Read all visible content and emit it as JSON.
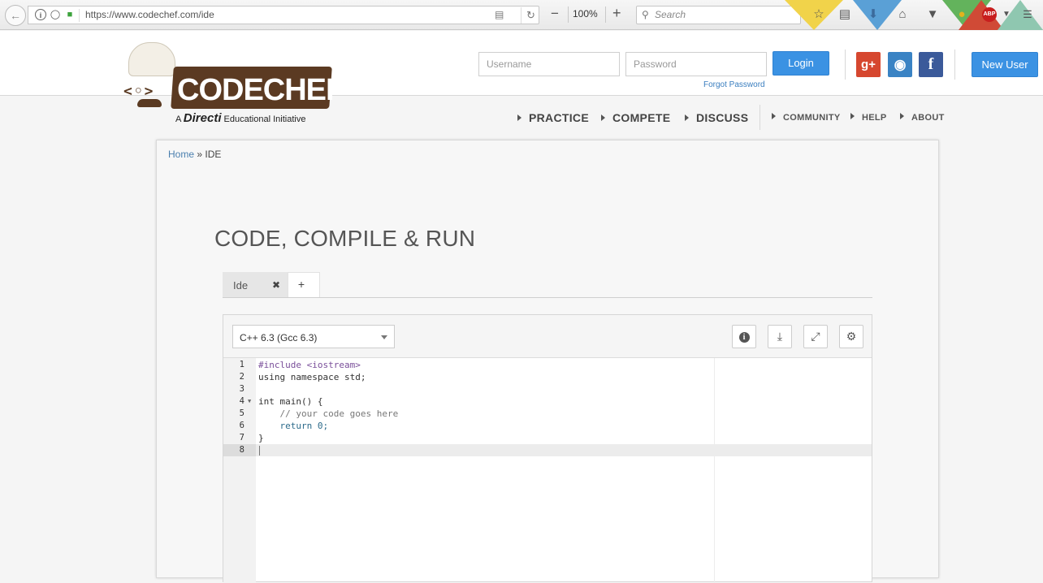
{
  "browser": {
    "back_icon": "back-arrow-icon",
    "url": "https://www.codechef.com/ide",
    "zoom_level": "100%",
    "zoom_out": "−",
    "zoom_in": "+",
    "search_placeholder": "Search"
  },
  "header": {
    "logo_text": "CODECHEF",
    "logo_brackets": "<◦>",
    "tagline_prefix": "A",
    "tagline_brand": "Directi",
    "tagline_suffix": "Educational Initiative",
    "username_placeholder": "Username",
    "password_placeholder": "Password",
    "login_label": "Login",
    "forgot_password": "Forgot Password",
    "new_user_label": "New User",
    "social": [
      {
        "label": "g+",
        "icon": "google-plus-icon"
      },
      {
        "label": "◉",
        "icon": "github-icon"
      },
      {
        "label": "f",
        "icon": "facebook-icon"
      }
    ]
  },
  "nav": {
    "main": [
      "PRACTICE",
      "COMPETE",
      "DISCUSS"
    ],
    "secondary": [
      "COMMUNITY",
      "HELP",
      "ABOUT"
    ]
  },
  "breadcrumb": {
    "home": "Home",
    "separator": "»",
    "current": "IDE"
  },
  "page": {
    "title": "CODE, COMPILE & RUN"
  },
  "tabs": {
    "items": [
      {
        "label": "Ide",
        "close": "✖"
      }
    ],
    "add_label": "+"
  },
  "editor": {
    "language": "C++ 6.3 (Gcc 6.3)",
    "tools": [
      {
        "name": "info-icon"
      },
      {
        "name": "download-icon"
      },
      {
        "name": "fullscreen-icon"
      },
      {
        "name": "settings-icon"
      }
    ],
    "lines": [
      {
        "n": "1",
        "text": "#include <iostream>"
      },
      {
        "n": "2",
        "text": "using namespace std;"
      },
      {
        "n": "3",
        "text": ""
      },
      {
        "n": "4",
        "text": "int main() {"
      },
      {
        "n": "5",
        "text": "    // your code goes here"
      },
      {
        "n": "6",
        "text": "    return 0;"
      },
      {
        "n": "7",
        "text": "}"
      },
      {
        "n": "8",
        "text": ""
      }
    ]
  }
}
